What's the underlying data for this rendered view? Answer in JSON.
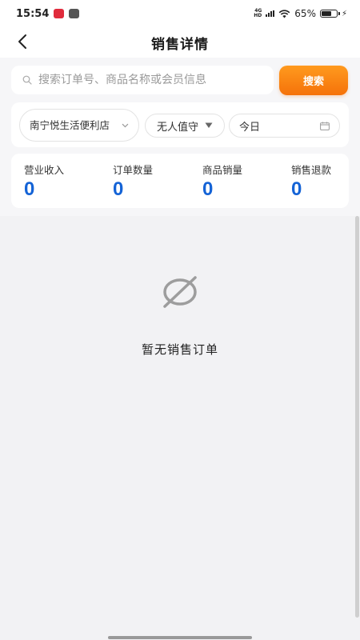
{
  "status_bar": {
    "time": "15:54",
    "network": "4G HD",
    "battery": "65%",
    "battery_level": 0.65
  },
  "header": {
    "title": "销售详情",
    "back_icon": "chevron-left-icon"
  },
  "search": {
    "placeholder": "搜索订单号、商品名称或会员信息",
    "value": "",
    "button_label": "搜索"
  },
  "filters": {
    "store": "南宁悦生活便利店",
    "mode": "无人值守",
    "date": "今日"
  },
  "stats": [
    {
      "label": "营业收入",
      "value": "0"
    },
    {
      "label": "订单数量",
      "value": "0"
    },
    {
      "label": "商品销量",
      "value": "0"
    },
    {
      "label": "销售退款",
      "value": "0"
    }
  ],
  "empty_state": {
    "icon": "empty-circle-slash-icon",
    "text": "暂无销售订单"
  },
  "colors": {
    "accent_orange": "#f5720a",
    "value_blue": "#1463d6",
    "background": "#f2f2f4"
  }
}
